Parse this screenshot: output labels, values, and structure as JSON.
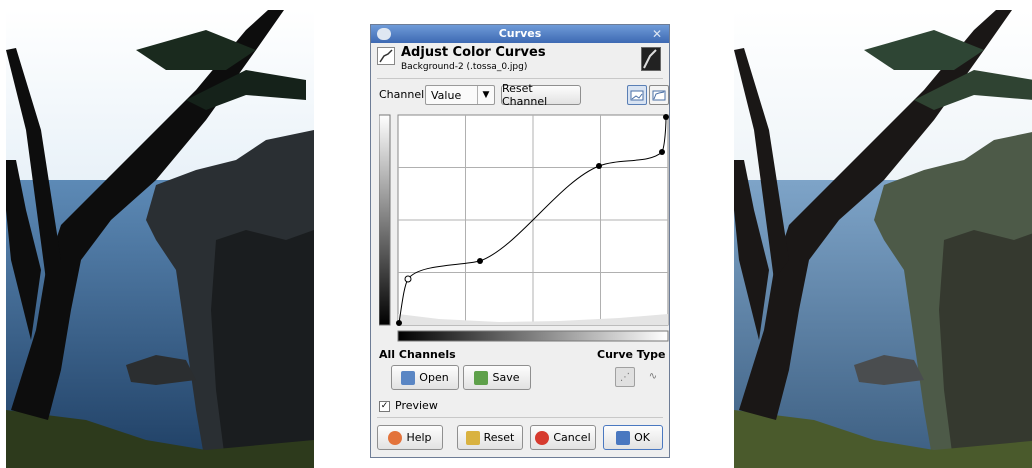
{
  "window": {
    "title": "Curves"
  },
  "header": {
    "title": "Adjust Color Curves",
    "subtitle": "Background-2 (.tossa_0.jpg)"
  },
  "channel": {
    "label": "Channel:",
    "value": "Value",
    "reset_label": "Reset Channel"
  },
  "sections": {
    "all_channels": "All Channels",
    "curve_type": "Curve Type"
  },
  "buttons": {
    "open": "Open",
    "save": "Save",
    "help": "Help",
    "reset": "Reset",
    "cancel": "Cancel",
    "ok": "OK"
  },
  "preview": {
    "label": "Preview",
    "checked": true
  },
  "icons": {
    "window_icon": "gimp-icon",
    "close": "close-icon",
    "header": "curves-tool-icon",
    "linear_hist": "linear-histogram-icon",
    "log_hist": "log-histogram-icon",
    "open": "folder-icon",
    "save": "save-icon",
    "help": "help-icon",
    "reset": "reset-icon",
    "cancel": "cancel-icon",
    "ok": "ok-icon",
    "smooth": "smooth-curve-icon",
    "freehand": "freehand-curve-icon"
  },
  "colors": {
    "titlebar": "#4a78c0",
    "dialog_bg": "#efefef"
  }
}
